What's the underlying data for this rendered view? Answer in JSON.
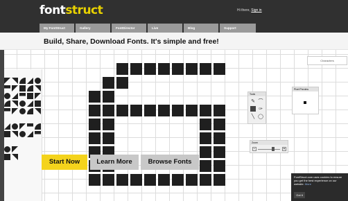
{
  "header": {
    "logo_prefix": "font",
    "logo_suffix": "struct",
    "greeting": "Hi there,",
    "sign_in": "Sign in"
  },
  "nav": {
    "tabs": [
      "My FontStruct",
      "Gallery",
      "FontDirector",
      "Live",
      "Blog",
      "Support"
    ]
  },
  "tagline": "Build, Share, Download Fonts. It's simple and free!",
  "editor": {
    "tools_title": "Tools",
    "zoom_title": "Zoom",
    "preview_title": "Pixel Preview",
    "characters_button": "Characters",
    "zoom_minus": "−",
    "zoom_plus": "+",
    "zoom_level": 0.7
  },
  "cta": {
    "start": "Start Now",
    "learn": "Learn More",
    "browse": "Browse Fonts"
  },
  "cookie": {
    "text": "FontStruct.com uses cookies to ensure you get the best experience on our website.",
    "more": "More",
    "button": "Got it"
  },
  "colors": {
    "header_bg": "#303030",
    "accent_yellow": "#f4d31c",
    "logo_accent": "#e8d100",
    "nav_tab": "#9a9a9a",
    "secondary_button": "#c8c8c8",
    "glyph_fill": "#1f1f1f"
  }
}
